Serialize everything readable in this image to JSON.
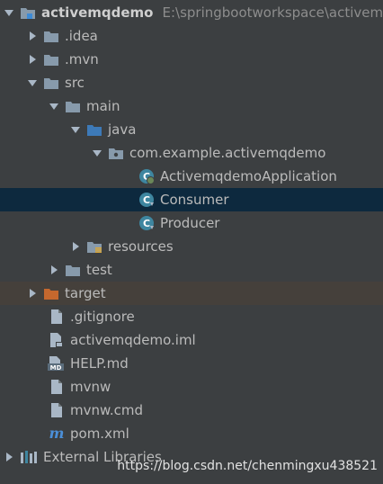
{
  "project": {
    "name": "activemqdemo",
    "path": "E:\\springbootworkspace\\activemqdemo"
  },
  "tree": {
    "idea": ".idea",
    "mvn": ".mvn",
    "src": "src",
    "main": "main",
    "java": "java",
    "package": "com.example.activemqdemo",
    "app_class": "ActivemqdemoApplication",
    "consumer_class": "Consumer",
    "producer_class": "Producer",
    "resources": "resources",
    "test": "test",
    "target": "target",
    "gitignore": ".gitignore",
    "iml": "activemqdemo.iml",
    "help": "HELP.md",
    "mvnw": "mvnw",
    "mvnw_cmd": "mvnw.cmd",
    "pom": "pom.xml",
    "external_libraries": "External Libraries"
  },
  "icons": {
    "class_badge": "C",
    "md_badge": "MD",
    "maven_badge": "m"
  },
  "watermark": "https://blog.csdn.net/chenmingxu438521",
  "colors": {
    "background": "#3c3f41",
    "selected_row": "#0d293e",
    "target_row": "#45403b",
    "folder": "#879aab",
    "folder_source": "#3d7ab8",
    "folder_target": "#c5682e",
    "class_icon": "#3e86a0",
    "text": "#bbbbbb",
    "path_text": "#8d8d8d"
  }
}
